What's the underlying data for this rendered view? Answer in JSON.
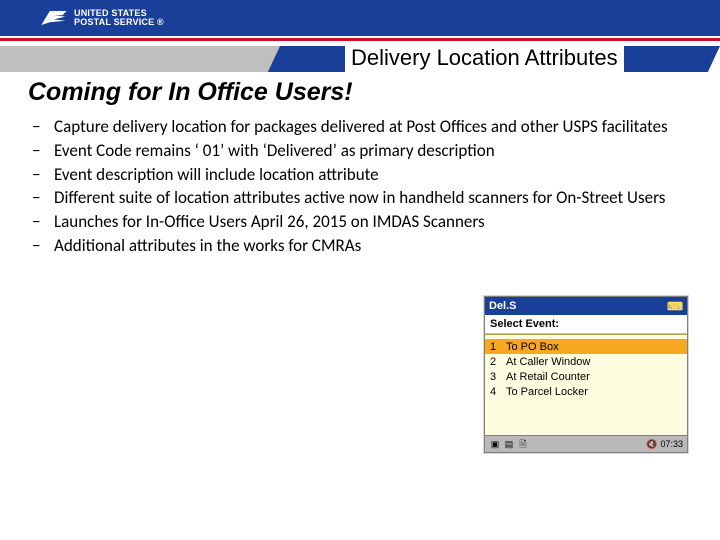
{
  "header": {
    "logo_top": "UNITED STATES",
    "logo_bottom": "POSTAL SERVICE ®"
  },
  "slide": {
    "title": "Delivery Location Attributes",
    "subtitle": "Coming for In Office Users!"
  },
  "bullets": [
    "Capture delivery location for packages delivered at Post Offices and other USPS facilitates",
    "Event Code remains ‘ 01’ with ‘Delivered’ as primary description",
    "Event description will include location attribute",
    "Different suite of location attributes active now in handheld scanners for On-Street Users",
    "Launches for In-Office Users April 26, 2015 on IMDAS Scanners",
    "Additional attributes in the works for CMRAs"
  ],
  "scanner": {
    "titlebar": "Del.S",
    "key_icon": "⌨",
    "prompt": "Select Event:",
    "items": [
      {
        "n": "1",
        "label": "To PO Box",
        "selected": true
      },
      {
        "n": "2",
        "label": "At Caller Window",
        "selected": false
      },
      {
        "n": "3",
        "label": "At Retail Counter",
        "selected": false
      },
      {
        "n": "4",
        "label": "To Parcel Locker",
        "selected": false
      }
    ],
    "status_time": "07:33",
    "speaker_icon": "🔇",
    "status_icon1": "▣",
    "status_icon2": "▤",
    "status_icon3": "🗎"
  }
}
